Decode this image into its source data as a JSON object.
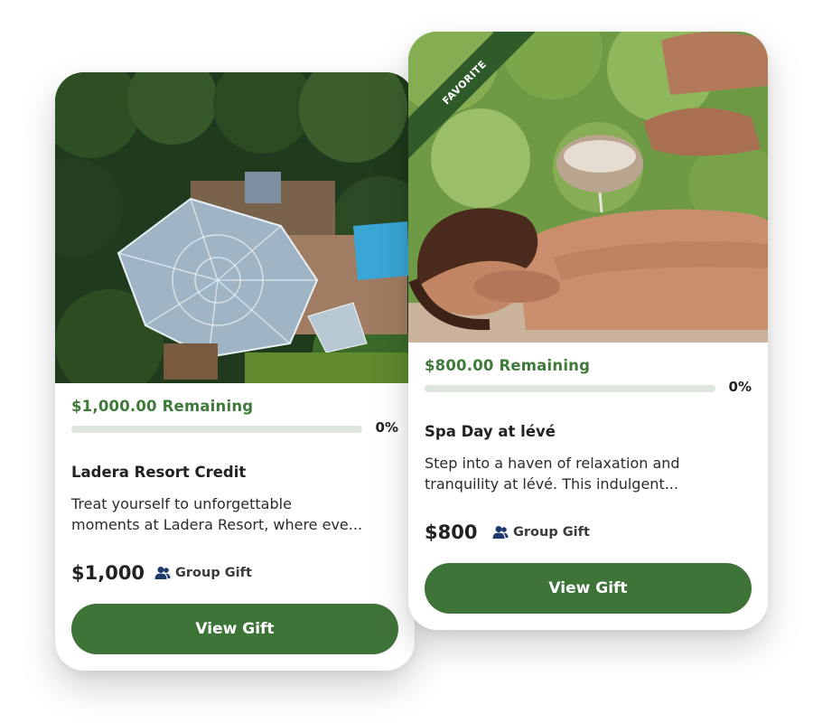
{
  "colors": {
    "accent_green": "#3f7a3b",
    "button_green": "#3f7438",
    "progress_track": "#dde6dc",
    "ribbon_green": "#2f5a2a",
    "group_icon": "#1f3b6e"
  },
  "cards": [
    {
      "image_subject": "aerial view of resort with glass domes, pool and forest",
      "remaining": "$1,000.00 Remaining",
      "progress": 0,
      "progress_label": "0%",
      "title": "Ladera Resort Credit",
      "description_line1": "Treat yourself to unforgettable",
      "description_line2": "moments at Ladera Resort, where eve...",
      "price": "$1,000",
      "group_label": "Group Gift",
      "group_icon": "people-icon",
      "button_label": "View Gift"
    },
    {
      "ribbon": "FAVORITE",
      "image_subject": "woman receiving a spa massage with oil bowl, forest background",
      "remaining": "$800.00 Remaining",
      "progress": 0,
      "progress_label": "0%",
      "title": "Spa Day at lévé",
      "description_line1": "Step into a haven of relaxation and",
      "description_line2": "tranquility at lévé. This indulgent...",
      "price": "$800",
      "group_label": "Group Gift",
      "group_icon": "people-icon",
      "button_label": "View Gift"
    }
  ]
}
